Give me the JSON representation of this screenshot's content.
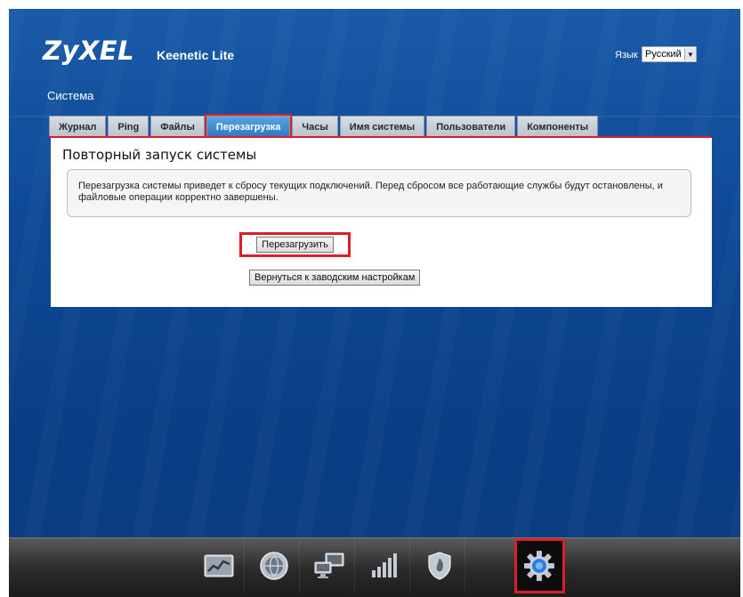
{
  "header": {
    "logo": "ZyXEL",
    "product": "Keenetic Lite",
    "language_label": "Язык",
    "language_value": "Русский"
  },
  "section": {
    "title": "Система"
  },
  "tabs": [
    {
      "label": "Журнал",
      "active": false
    },
    {
      "label": "Ping",
      "active": false
    },
    {
      "label": "Файлы",
      "active": false
    },
    {
      "label": "Перезагрузка",
      "active": true
    },
    {
      "label": "Часы",
      "active": false
    },
    {
      "label": "Имя системы",
      "active": false
    },
    {
      "label": "Пользователи",
      "active": false
    },
    {
      "label": "Компоненты",
      "active": false
    }
  ],
  "panel": {
    "title": "Повторный запуск системы",
    "info": "Перезагрузка системы приведет к сбросу текущих подключений. Перед сбросом все работающие службы будут остановлены, и файловые операции корректно завершены.",
    "reboot_button": "Перезагрузить",
    "factory_button": "Вернуться к заводским настройкам"
  },
  "bottom_nav": [
    {
      "icon": "monitoring-chart-icon",
      "active": false
    },
    {
      "icon": "globe-internet-icon",
      "active": false
    },
    {
      "icon": "home-network-icon",
      "active": false
    },
    {
      "icon": "wifi-signal-icon",
      "active": false
    },
    {
      "icon": "security-shield-icon",
      "active": false
    },
    {
      "icon": "system-gear-icon",
      "active": true
    }
  ],
  "colors": {
    "background": "#0e4a97",
    "highlight": "#d9202a",
    "active_tab": "#2c79c4"
  }
}
